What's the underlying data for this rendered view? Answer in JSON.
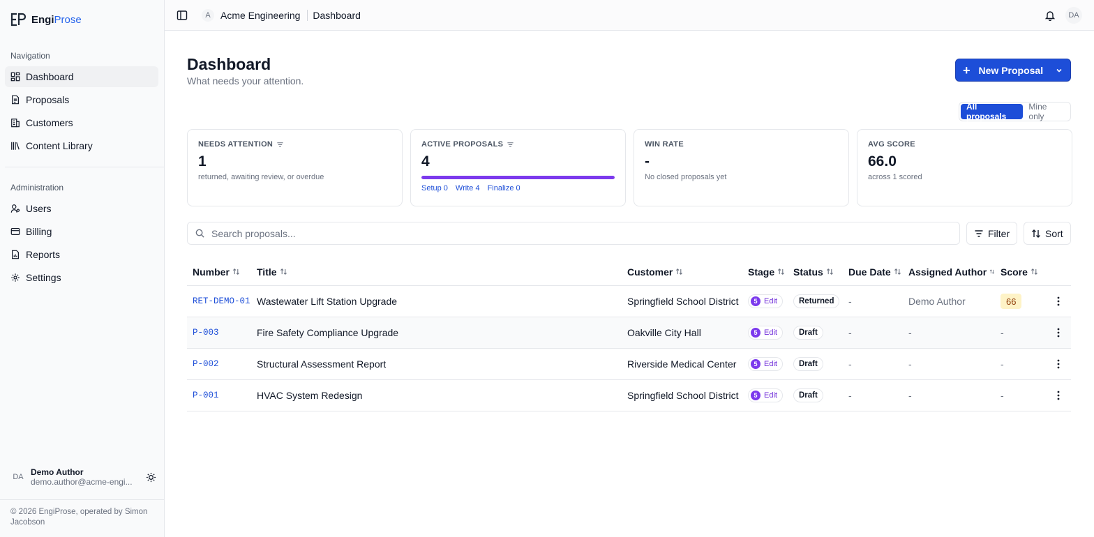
{
  "brand": {
    "name_prefix": "Engi",
    "name_suffix": "Prose"
  },
  "sidebar": {
    "navigation_label": "Navigation",
    "navigation": [
      {
        "label": "Dashboard",
        "icon": "dashboard-icon",
        "active": true
      },
      {
        "label": "Proposals",
        "icon": "document-icon"
      },
      {
        "label": "Customers",
        "icon": "building-icon"
      },
      {
        "label": "Content Library",
        "icon": "library-icon"
      }
    ],
    "administration_label": "Administration",
    "administration": [
      {
        "label": "Users",
        "icon": "users-icon"
      },
      {
        "label": "Billing",
        "icon": "card-icon"
      },
      {
        "label": "Reports",
        "icon": "report-icon"
      },
      {
        "label": "Settings",
        "icon": "gear-icon"
      }
    ],
    "user": {
      "initials": "DA",
      "name": "Demo Author",
      "email": "demo.author@acme-engi..."
    },
    "copyright": "© 2026 EngiProse, operated by Simon Jacobson"
  },
  "topbar": {
    "org_initial": "A",
    "org_name": "Acme Engineering",
    "current_page": "Dashboard",
    "user_initials": "DA"
  },
  "page": {
    "title": "Dashboard",
    "subtitle": "What needs your attention.",
    "new_proposal_label": "New Proposal",
    "scope_toggle": {
      "all_label": "All proposals",
      "mine_label": "Mine only",
      "selected": "all"
    }
  },
  "stats": {
    "needs_attention": {
      "label": "Needs Attention",
      "value": "1",
      "desc": "returned, awaiting review, or overdue"
    },
    "active_proposals": {
      "label": "Active Proposals",
      "value": "4",
      "progress_fraction": 1.0,
      "stages": {
        "setup": "Setup 0",
        "write": "Write 4",
        "finalize": "Finalize 0"
      }
    },
    "win_rate": {
      "label": "Win Rate",
      "value": "-",
      "desc": "No closed proposals yet"
    },
    "avg_score": {
      "label": "Avg Score",
      "value": "66.0",
      "desc": "across 1 scored"
    }
  },
  "search": {
    "placeholder": "Search proposals..."
  },
  "toolbar": {
    "filter_label": "Filter",
    "sort_label": "Sort"
  },
  "table": {
    "headers": {
      "number": "Number",
      "title": "Title",
      "customer": "Customer",
      "stage": "Stage",
      "status": "Status",
      "due_date": "Due Date",
      "author": "Assigned Author",
      "score": "Score"
    },
    "rows": [
      {
        "number": "RET-DEMO-01",
        "title": "Wastewater Lift Station Upgrade",
        "customer": "Springfield School District",
        "stage_num": "5",
        "stage_label": "Edit",
        "status": "Returned",
        "due": "-",
        "author": "Demo Author",
        "score": "66"
      },
      {
        "number": "P-003",
        "title": "Fire Safety Compliance Upgrade",
        "customer": "Oakville City Hall",
        "stage_num": "5",
        "stage_label": "Edit",
        "status": "Draft",
        "due": "-",
        "author": "-",
        "score": "-"
      },
      {
        "number": "P-002",
        "title": "Structural Assessment Report",
        "customer": "Riverside Medical Center",
        "stage_num": "5",
        "stage_label": "Edit",
        "status": "Draft",
        "due": "-",
        "author": "-",
        "score": "-"
      },
      {
        "number": "P-001",
        "title": "HVAC System Redesign",
        "customer": "Springfield School District",
        "stage_num": "5",
        "stage_label": "Edit",
        "status": "Draft",
        "due": "-",
        "author": "-",
        "score": "-"
      }
    ]
  },
  "colors": {
    "accent": "#1d4ed8",
    "stage_purple": "#7c3aed",
    "score_bg": "#fef3c7"
  }
}
